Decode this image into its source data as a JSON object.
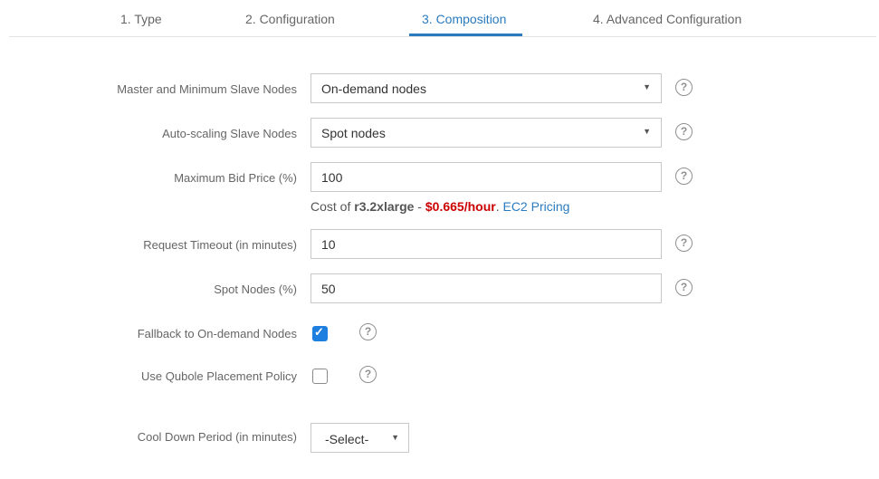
{
  "tabs": [
    {
      "label": "1. Type",
      "active": false
    },
    {
      "label": "2. Configuration",
      "active": false
    },
    {
      "label": "3. Composition",
      "active": true
    },
    {
      "label": "4. Advanced Configuration",
      "active": false
    }
  ],
  "colors": {
    "accent": "#2a7bbf",
    "price": "#cc0000",
    "checkbox": "#1f7fe0"
  },
  "form": {
    "master_nodes": {
      "label": "Master and Minimum Slave Nodes",
      "value": "On-demand nodes"
    },
    "autoscaling_nodes": {
      "label": "Auto-scaling Slave Nodes",
      "value": "Spot nodes"
    },
    "max_bid": {
      "label": "Maximum Bid Price (%)",
      "value": "100"
    },
    "cost": {
      "prefix": "Cost of ",
      "instance": "r3.2xlarge",
      "separator": " - ",
      "price": "$0.665/hour",
      "dot": ".",
      "link": "EC2 Pricing"
    },
    "request_timeout": {
      "label": "Request Timeout (in minutes)",
      "value": "10"
    },
    "spot_nodes": {
      "label": "Spot Nodes (%)",
      "value": "50"
    },
    "fallback": {
      "label": "Fallback to On-demand Nodes",
      "checked": true
    },
    "placement": {
      "label": "Use Qubole Placement Policy",
      "checked": false
    },
    "cooldown": {
      "label": "Cool Down Period (in minutes)",
      "value": "-Select-"
    }
  },
  "icons": {
    "help": "?",
    "caret": "▼",
    "check": "✓"
  }
}
